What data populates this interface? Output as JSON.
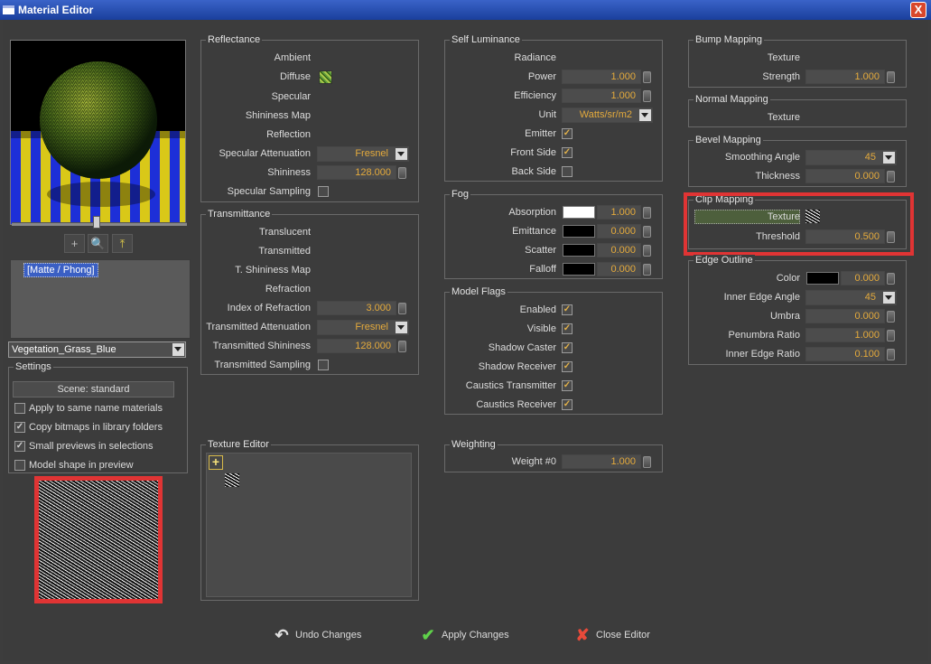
{
  "window": {
    "title": "Material Editor",
    "close": "X"
  },
  "toolbar": {
    "zoom_icon": "+",
    "search_icon": "🔍",
    "export_icon": "⤒"
  },
  "material": {
    "list_item": "[Matte / Phong]",
    "selected": "Vegetation_Grass_Blue"
  },
  "settings": {
    "title": "Settings",
    "scene_button": "Scene: standard",
    "options": [
      {
        "label": "Apply to same name materials",
        "checked": false
      },
      {
        "label": "Copy bitmaps in library folders",
        "checked": true
      },
      {
        "label": "Small previews in selections",
        "checked": true
      },
      {
        "label": "Model shape in preview",
        "checked": false
      }
    ]
  },
  "reflectance": {
    "title": "Reflectance",
    "ambient": "Ambient",
    "diffuse": "Diffuse",
    "specular": "Specular",
    "shininess_map": "Shininess Map",
    "reflection": "Reflection",
    "specular_attenuation": "Specular Attenuation",
    "specular_attenuation_value": "Fresnel",
    "shininess": "Shininess",
    "shininess_value": "128.000",
    "specular_sampling": "Specular Sampling"
  },
  "transmittance": {
    "title": "Transmittance",
    "translucent": "Translucent",
    "transmitted": "Transmitted",
    "t_shininess_map": "T. Shininess Map",
    "refraction": "Refraction",
    "ior": "Index of Refraction",
    "ior_value": "3.000",
    "attenuation": "Transmitted Attenuation",
    "attenuation_value": "Fresnel",
    "shininess": "Transmitted Shininess",
    "shininess_value": "128.000",
    "sampling": "Transmitted Sampling"
  },
  "texture_editor": {
    "title": "Texture Editor",
    "add": "+"
  },
  "self_luminance": {
    "title": "Self Luminance",
    "radiance": "Radiance",
    "power": "Power",
    "power_value": "1.000",
    "efficiency": "Efficiency",
    "efficiency_value": "1.000",
    "unit": "Unit",
    "unit_value": "Watts/sr/m2",
    "emitter": "Emitter",
    "front_side": "Front Side",
    "back_side": "Back Side"
  },
  "fog": {
    "title": "Fog",
    "absorption": "Absorption",
    "absorption_value": "1.000",
    "emittance": "Emittance",
    "emittance_value": "0.000",
    "scatter": "Scatter",
    "scatter_value": "0.000",
    "falloff": "Falloff",
    "falloff_value": "0.000"
  },
  "model_flags": {
    "title": "Model Flags",
    "enabled": "Enabled",
    "visible": "Visible",
    "shadow_caster": "Shadow Caster",
    "shadow_receiver": "Shadow Receiver",
    "caustics_transmitter": "Caustics Transmitter",
    "caustics_receiver": "Caustics Receiver"
  },
  "weighting": {
    "title": "Weighting",
    "weight0": "Weight #0",
    "weight0_value": "1.000"
  },
  "bump": {
    "title": "Bump Mapping",
    "texture": "Texture",
    "strength": "Strength",
    "strength_value": "1.000"
  },
  "normal": {
    "title": "Normal Mapping",
    "texture": "Texture"
  },
  "bevel": {
    "title": "Bevel Mapping",
    "smoothing_angle": "Smoothing Angle",
    "smoothing_angle_value": "45",
    "thickness": "Thickness",
    "thickness_value": "0.000"
  },
  "clip": {
    "title": "Clip Mapping",
    "texture": "Texture",
    "threshold": "Threshold",
    "threshold_value": "0.500"
  },
  "edge": {
    "title": "Edge Outline",
    "color": "Color",
    "color_value": "0.000",
    "inner_edge_angle": "Inner Edge Angle",
    "inner_edge_angle_value": "45",
    "umbra": "Umbra",
    "umbra_value": "0.000",
    "penumbra_ratio": "Penumbra Ratio",
    "penumbra_ratio_value": "1.000",
    "inner_edge_ratio": "Inner Edge Ratio",
    "inner_edge_ratio_value": "0.100"
  },
  "buttons": {
    "undo": "Undo Changes",
    "apply": "Apply Changes",
    "close": "Close Editor"
  },
  "colors": {
    "accent_red": "#e03434",
    "value_orange": "#e4aa3c",
    "selection_blue": "#3a5fc4"
  }
}
